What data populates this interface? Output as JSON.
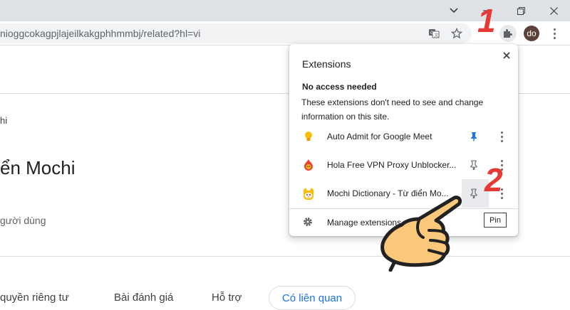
{
  "window": {
    "minimize_glyph": "⌄",
    "restore_glyph": "❐",
    "close_glyph": "✕"
  },
  "toolbar": {
    "url": "nioggcokagpjlajeilkakgphhmmbj/related?hl=vi",
    "avatar_initials": "do",
    "icons": [
      "translate-icon",
      "star-icon",
      "extensions-puzzle-icon",
      "more-vert-icon"
    ]
  },
  "page": {
    "breadcrumb_tail": "hi",
    "title_fragment": "ển Mochi",
    "users_fragment": "gười dùng",
    "tabs": [
      {
        "label": "quyền riêng tư"
      },
      {
        "label": "Bài đánh giá"
      },
      {
        "label": "Hỗ trợ"
      },
      {
        "label": "Có liên quan"
      }
    ]
  },
  "extensions_popup": {
    "title": "Extensions",
    "close_glyph": "✕",
    "section_heading": "No access needed",
    "section_description": "These extensions don't need to see and change information on this site.",
    "items": [
      {
        "name": "Auto Admit for Google Meet",
        "pinned": true,
        "icon": "lightbulb-icon"
      },
      {
        "name": "Hola Free VPN Proxy Unblocker...",
        "pinned": false,
        "icon": "hola-flame-icon"
      },
      {
        "name": "Mochi Dictionary - Từ điển Mo...",
        "pinned": false,
        "icon": "mochi-cat-icon"
      }
    ],
    "manage_label": "Manage extensions",
    "pin_tooltip": "Pin"
  },
  "annotations": {
    "step1": "1",
    "step2": "2"
  },
  "colors": {
    "titlebar": "#dee1e6",
    "pinned_blue": "#1a73e8",
    "step_red": "#e53935",
    "hand_fill": "#f9c87a"
  }
}
